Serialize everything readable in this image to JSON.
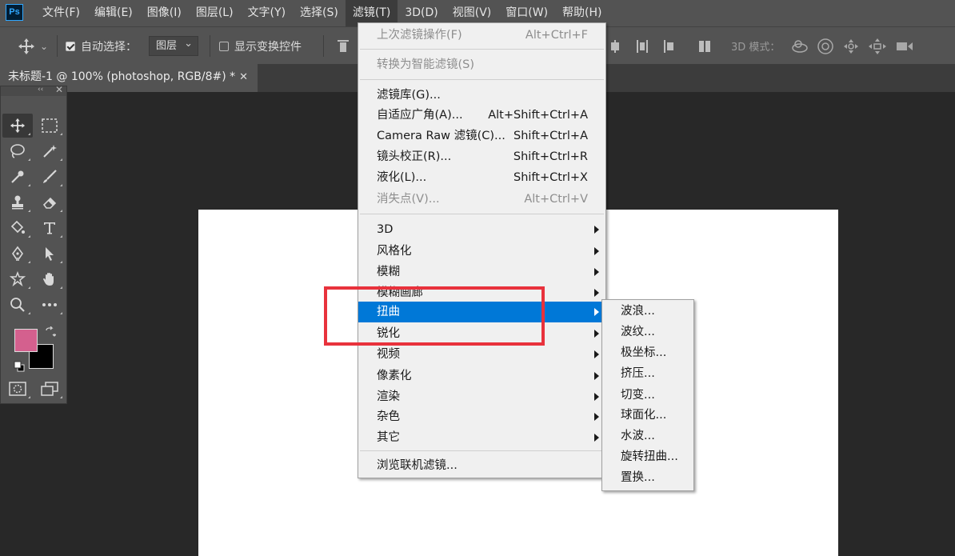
{
  "app": {
    "logo": "Ps"
  },
  "menubar": {
    "items": [
      "文件(F)",
      "编辑(E)",
      "图像(I)",
      "图层(L)",
      "文字(Y)",
      "选择(S)",
      "滤镜(T)",
      "3D(D)",
      "视图(V)",
      "窗口(W)",
      "帮助(H)"
    ],
    "active_index": 6
  },
  "options": {
    "auto_select_label": "自动选择：",
    "auto_select_checked": true,
    "layer_select_value": "图层",
    "show_transform_label": "显示变换控件",
    "show_transform_checked": false,
    "mode_3d_label": "3D 模式："
  },
  "document_tab": {
    "title": "未标题-1 @ 100% (photoshop, RGB/8#) *",
    "close": "✕"
  },
  "toolbox": {
    "collapse_glyph": "‹‹",
    "close_glyph": "✕",
    "foreground_color": "#d4608e",
    "background_color": "#000000"
  },
  "filter_menu": {
    "items": [
      {
        "label": "上次滤镜操作(F)",
        "shortcut": "Alt+Ctrl+F",
        "disabled": true
      },
      {
        "label": "转换为智能滤镜(S)",
        "disabled": true
      },
      {
        "label": "滤镜库(G)..."
      },
      {
        "label": "自适应广角(A)...",
        "shortcut": "Alt+Shift+Ctrl+A"
      },
      {
        "label": "Camera Raw 滤镜(C)...",
        "shortcut": "Shift+Ctrl+A"
      },
      {
        "label": "镜头校正(R)...",
        "shortcut": "Shift+Ctrl+R"
      },
      {
        "label": "液化(L)...",
        "shortcut": "Shift+Ctrl+X"
      },
      {
        "label": "消失点(V)...",
        "shortcut": "Alt+Ctrl+V",
        "disabled": true
      },
      {
        "label": "3D",
        "submenu": true
      },
      {
        "label": "风格化",
        "submenu": true
      },
      {
        "label": "模糊",
        "submenu": true
      },
      {
        "label": "模糊画廊",
        "submenu": true
      },
      {
        "label": "扭曲",
        "submenu": true,
        "highlighted": true
      },
      {
        "label": "锐化",
        "submenu": true
      },
      {
        "label": "视频",
        "submenu": true
      },
      {
        "label": "像素化",
        "submenu": true
      },
      {
        "label": "渲染",
        "submenu": true
      },
      {
        "label": "杂色",
        "submenu": true
      },
      {
        "label": "其它",
        "submenu": true
      },
      {
        "label": "浏览联机滤镜..."
      }
    ]
  },
  "distort_submenu": {
    "items": [
      "波浪...",
      "波纹...",
      "极坐标...",
      "挤压...",
      "切变...",
      "球面化...",
      "水波...",
      "旋转扭曲...",
      "置换..."
    ]
  },
  "colors": {
    "highlight": "#0078d7",
    "annotation": "#e8323c",
    "canvas": "#ffffff"
  }
}
